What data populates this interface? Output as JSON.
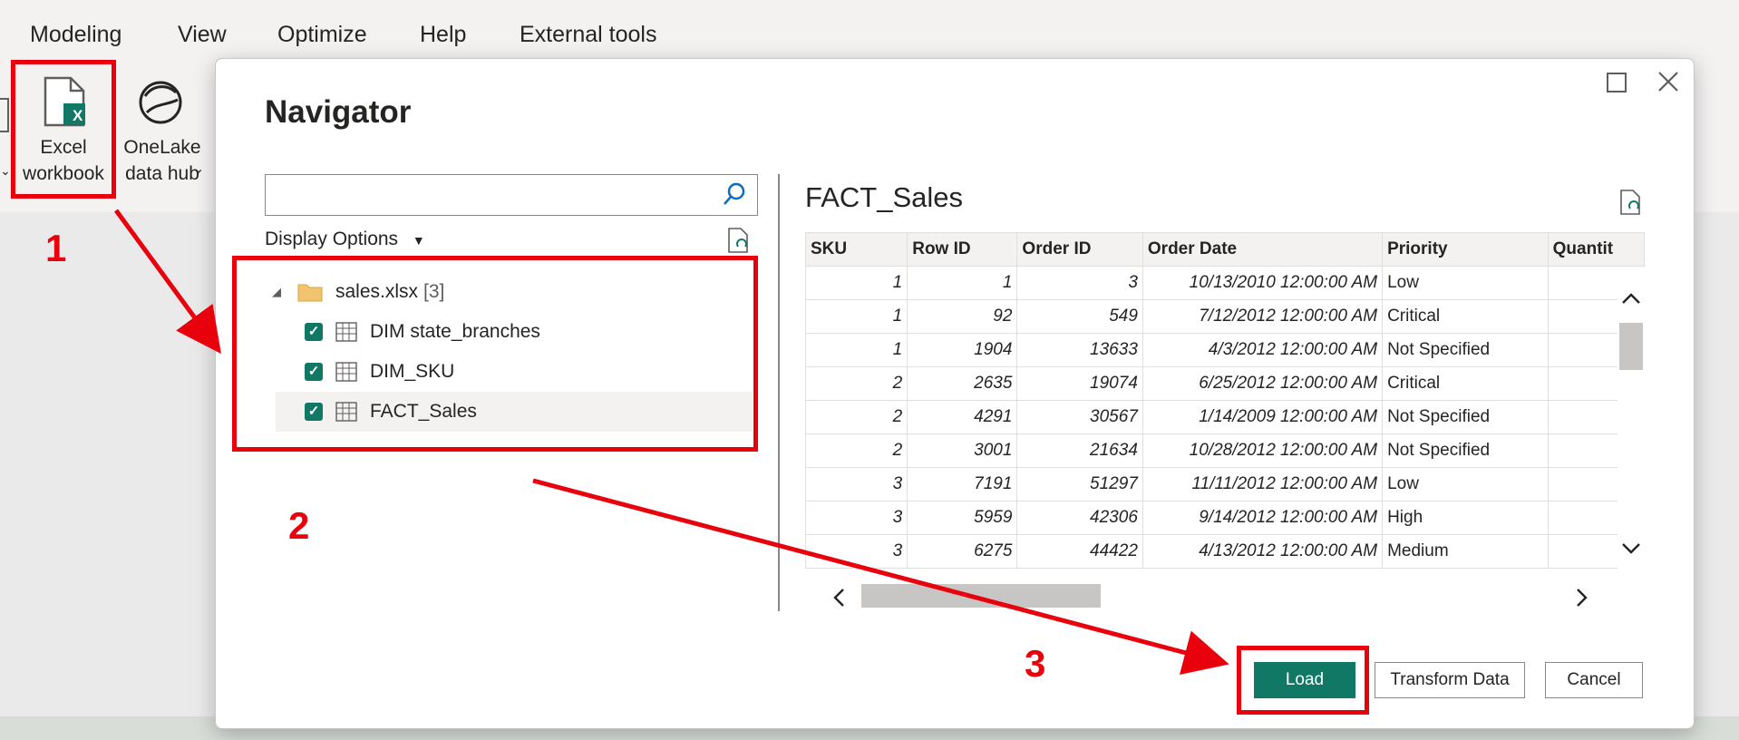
{
  "menu": [
    "Modeling",
    "View",
    "Optimize",
    "Help",
    "External tools"
  ],
  "ribbon": {
    "excel_line1": "Excel",
    "excel_line2": "workbook",
    "onelake_line1": "OneLake",
    "onelake_line2": "data hub",
    "excel_icon_letter": "X"
  },
  "dialog": {
    "title": "Navigator",
    "search_placeholder": "",
    "display_options": "Display Options",
    "tree": {
      "file_name": "sales.xlsx",
      "file_count": "[3]",
      "items": [
        {
          "label": "DIM state_branches",
          "checked": true
        },
        {
          "label": "DIM_SKU",
          "checked": true
        },
        {
          "label": "FACT_Sales",
          "checked": true,
          "selected": true
        }
      ]
    },
    "preview": {
      "title": "FACT_Sales",
      "columns": [
        "SKU",
        "Row ID",
        "Order ID",
        "Order Date",
        "Priority",
        "Quantit"
      ],
      "rows": [
        [
          "1",
          "1",
          "3",
          "10/13/2010 12:00:00 AM",
          "Low",
          ""
        ],
        [
          "1",
          "92",
          "549",
          "7/12/2012 12:00:00 AM",
          "Critical",
          ""
        ],
        [
          "1",
          "1904",
          "13633",
          "4/3/2012 12:00:00 AM",
          "Not Specified",
          ""
        ],
        [
          "2",
          "2635",
          "19074",
          "6/25/2012 12:00:00 AM",
          "Critical",
          ""
        ],
        [
          "2",
          "4291",
          "30567",
          "1/14/2009 12:00:00 AM",
          "Not Specified",
          ""
        ],
        [
          "2",
          "3001",
          "21634",
          "10/28/2012 12:00:00 AM",
          "Not Specified",
          ""
        ],
        [
          "3",
          "7191",
          "51297",
          "11/11/2012 12:00:00 AM",
          "Low",
          ""
        ],
        [
          "3",
          "5959",
          "42306",
          "9/14/2012 12:00:00 AM",
          "High",
          ""
        ],
        [
          "3",
          "6275",
          "44422",
          "4/13/2012 12:00:00 AM",
          "Medium",
          ""
        ]
      ]
    },
    "buttons": {
      "load": "Load",
      "transform": "Transform Data",
      "cancel": "Cancel"
    }
  },
  "annotations": {
    "step1": "1",
    "step2": "2",
    "step3": "3"
  },
  "colors": {
    "accent": "#117865",
    "annotation": "#e8000d"
  }
}
